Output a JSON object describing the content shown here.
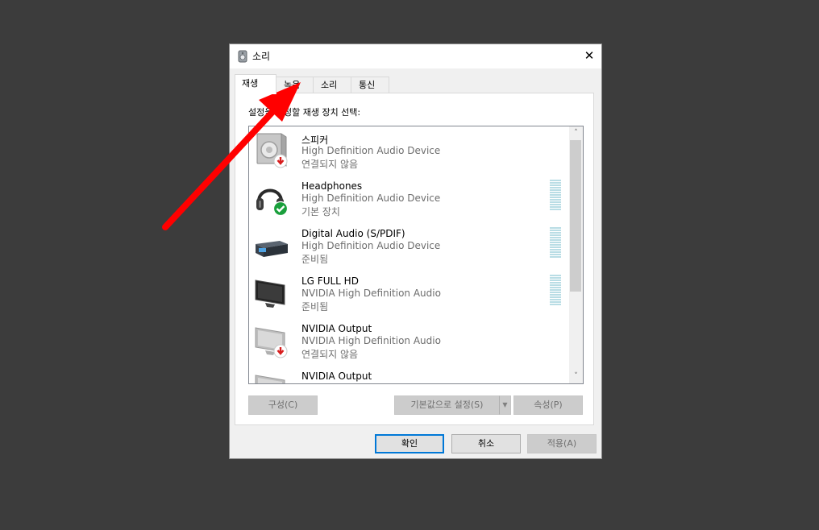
{
  "window": {
    "title": "소리",
    "close_symbol": "✕"
  },
  "tabs": [
    {
      "label": "재생",
      "active": true
    },
    {
      "label": "녹음",
      "active": false
    },
    {
      "label": "소리",
      "active": false
    },
    {
      "label": "통신",
      "active": false
    }
  ],
  "panel": {
    "instruction": "설정을 수정할 재생 장치 선택:"
  },
  "devices": [
    {
      "name": "스피커",
      "description": "High Definition Audio Device",
      "status": "연결되지 않음",
      "icon": "speaker-icon",
      "badge": "disconnected-badge-icon"
    },
    {
      "name": "Headphones",
      "description": "High Definition Audio Device",
      "status": "기본 장치",
      "icon": "headphones-icon",
      "badge": "default-device-check-icon"
    },
    {
      "name": "Digital Audio (S/PDIF)",
      "description": "High Definition Audio Device",
      "status": "준비됨",
      "icon": "digital-audio-receiver-icon"
    },
    {
      "name": "LG FULL HD",
      "description": "NVIDIA High Definition Audio",
      "status": "준비됨",
      "icon": "monitor-icon"
    },
    {
      "name": "NVIDIA Output",
      "description": "NVIDIA High Definition Audio",
      "status": "연결되지 않음",
      "icon": "monitor-disabled-icon",
      "badge": "disconnected-badge-icon"
    },
    {
      "name": "NVIDIA Output",
      "description": "",
      "status": "",
      "icon": "monitor-disabled-icon"
    }
  ],
  "scroll": {
    "up": "˄",
    "down": "˅"
  },
  "buttons": {
    "configure": "구성(C)",
    "set_default": "기본값으로 설정(S)",
    "split_arrow": "▼",
    "properties": "속성(P)",
    "ok": "확인",
    "cancel": "취소",
    "apply": "적용(A)"
  },
  "colors": {
    "annotation_arrow": "#ff0000",
    "default_button_border": "#0078d7",
    "check_badge": "#1a9f3c",
    "disconnected_badge": "#d81e1e",
    "level_meter": "#b9dde5"
  }
}
